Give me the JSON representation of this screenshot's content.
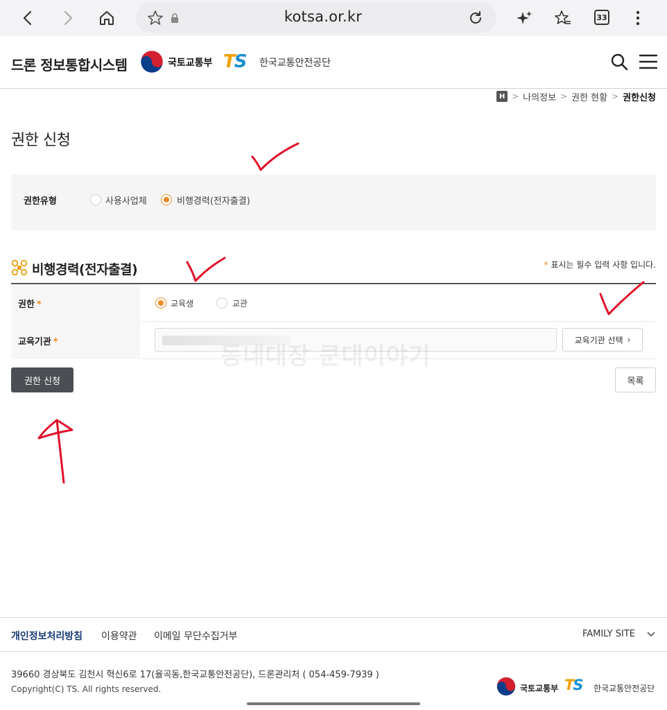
{
  "browser": {
    "url": "kotsa.or.kr",
    "tab_count": "33"
  },
  "header": {
    "site_title": "드론 정보통합시스템",
    "ministry_name": "국토교통부",
    "agency_logo": "TS",
    "agency_name": "한국교통안전공단"
  },
  "breadcrumb": {
    "home": "H",
    "items": [
      "나의정보",
      "권한 현황",
      "권한신청"
    ]
  },
  "page": {
    "title": "권한 신청"
  },
  "auth_type": {
    "label": "권한유형",
    "options": [
      {
        "label": "사용사업체",
        "selected": false
      },
      {
        "label": "비행경력(전자출결)",
        "selected": true
      }
    ]
  },
  "section": {
    "title": "비행경력(전자출결)",
    "required_star": "*",
    "required_note": "표시는 필수 입력 사항 입니다."
  },
  "form": {
    "role": {
      "label": "권한",
      "star": "*",
      "options": [
        {
          "label": "교육생",
          "selected": true
        },
        {
          "label": "교관",
          "selected": false
        }
      ]
    },
    "institution": {
      "label": "교육기관",
      "star": "*",
      "button": "교육기관 선택"
    }
  },
  "watermark": "동네대장 쿤대이야기",
  "buttons": {
    "apply": "권한 신청",
    "list": "목록"
  },
  "footer": {
    "links": [
      "개인정보처리방침",
      "이용약관",
      "이메일 무단수집거부"
    ],
    "family_site": "FAMILY SITE",
    "address": "39660 경상북도 김천시 혁신6로 17(율곡동,한국교통안전공단), 드론관리처 ( 054-459-7939 )",
    "copyright": "Copyright(C) TS. All rights reserved.",
    "ministry_name": "국토교통부",
    "agency_logo": "TS",
    "agency_name": "한국교통안전공단"
  },
  "colors": {
    "accent": "#f08a24",
    "dark_button": "#4b4f53",
    "annotation": "#e0102a",
    "footer_link": "#173a72"
  }
}
